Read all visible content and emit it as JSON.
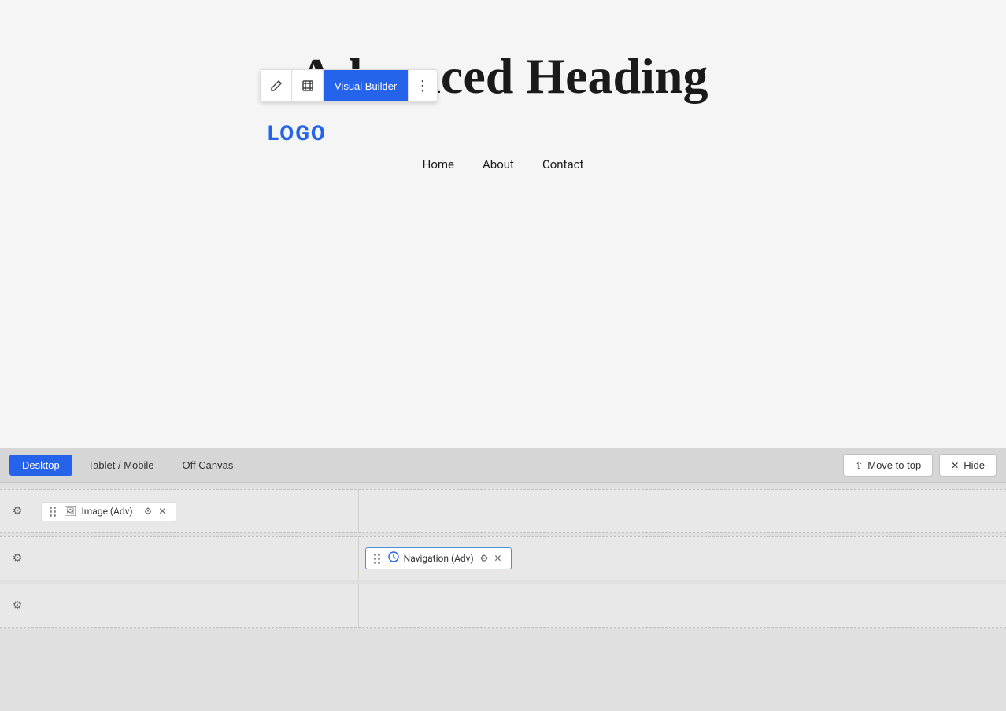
{
  "canvas": {
    "heading": "Advanced Heading",
    "logo": "LOGO",
    "nav": {
      "items": [
        {
          "label": "Home"
        },
        {
          "label": "About"
        },
        {
          "label": "Contact"
        }
      ]
    }
  },
  "toolbar": {
    "edit_icon": "✎",
    "frame_icon": "⧉",
    "visual_builder_label": "Visual Builder",
    "more_icon": "⋮"
  },
  "bottom_panel": {
    "view_tabs": [
      {
        "label": "Desktop",
        "active": true
      },
      {
        "label": "Tablet / Mobile",
        "active": false
      },
      {
        "label": "Off Canvas",
        "active": false
      }
    ],
    "move_to_top_label": "Move to top",
    "hide_label": "Hide",
    "rows": [
      {
        "gear_icon": "⚙",
        "columns": [
          {
            "widget": {
              "drag_icon": "⠿",
              "icon": "🖼",
              "label": "Image (Adv)",
              "has_settings": true,
              "has_close": true
            }
          },
          {
            "widget": null
          },
          {
            "widget": null
          }
        ]
      },
      {
        "gear_icon": "⚙",
        "columns": [
          {
            "widget": null
          },
          {
            "widget": {
              "drag_icon": "⠿",
              "icon": "🧭",
              "label": "Navigation (Adv)",
              "is_nav": true,
              "has_settings": true,
              "has_close": true
            }
          },
          {
            "widget": null
          }
        ]
      },
      {
        "gear_icon": "⚙",
        "columns": [
          {
            "widget": null
          },
          {
            "widget": null
          },
          {
            "widget": null
          }
        ]
      }
    ]
  }
}
